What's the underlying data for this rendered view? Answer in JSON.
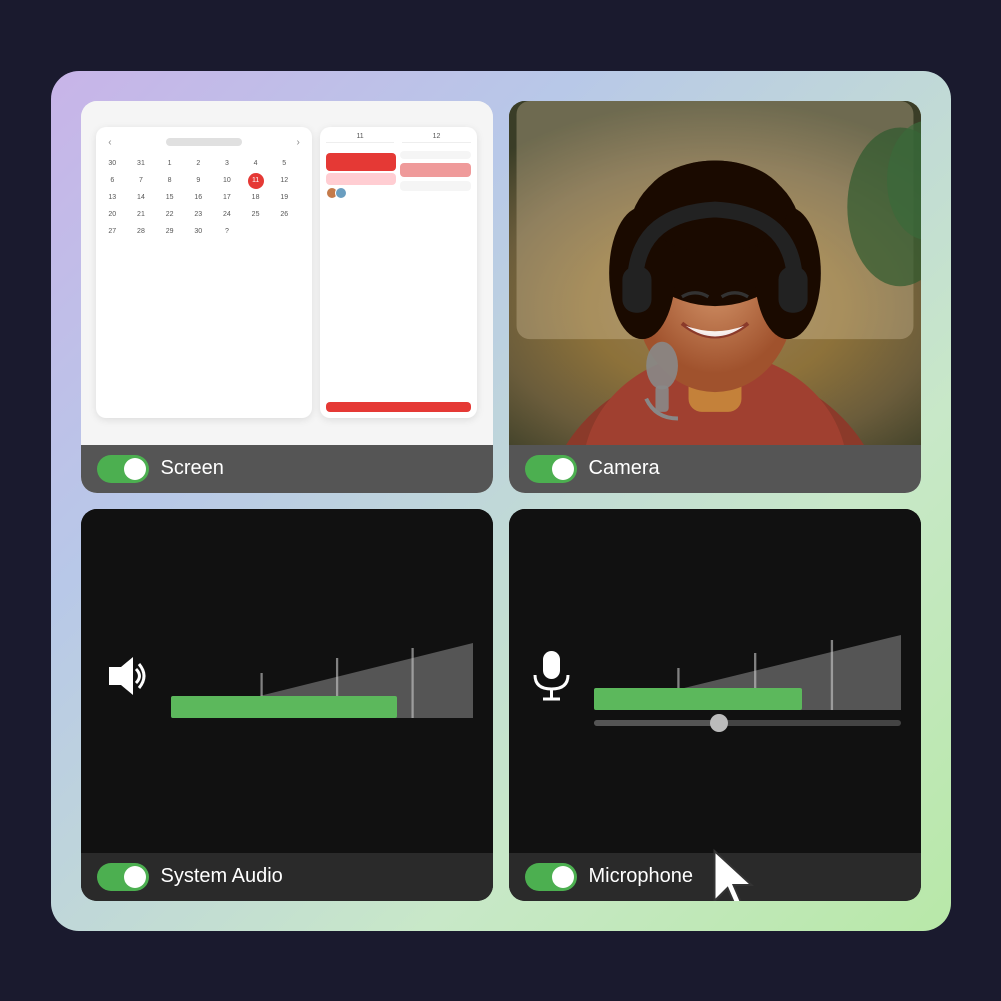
{
  "background": {
    "gradient": "linear-gradient(135deg, #c8b4e8, #b8c8e8, #c8e8c8, #b8e8a8)"
  },
  "cards": {
    "screen": {
      "label": "Screen",
      "toggle_on": true
    },
    "camera": {
      "label": "Camera",
      "toggle_on": true
    },
    "audio": {
      "label": "System Audio",
      "toggle_on": true
    },
    "mic": {
      "label": "Microphone",
      "toggle_on": true
    }
  },
  "calendar": {
    "days": [
      "30",
      "31",
      "1",
      "2",
      "3",
      "4",
      "5",
      "6",
      "7",
      "8",
      "9",
      "10",
      "11",
      "12",
      "13",
      "14",
      "15",
      "16",
      "17",
      "18",
      "19",
      "20",
      "21",
      "22",
      "23",
      "24",
      "25",
      "26",
      "27",
      "28",
      "29",
      "30",
      "?"
    ],
    "highlighted_day": "11",
    "col1": "11",
    "col2": "12"
  }
}
